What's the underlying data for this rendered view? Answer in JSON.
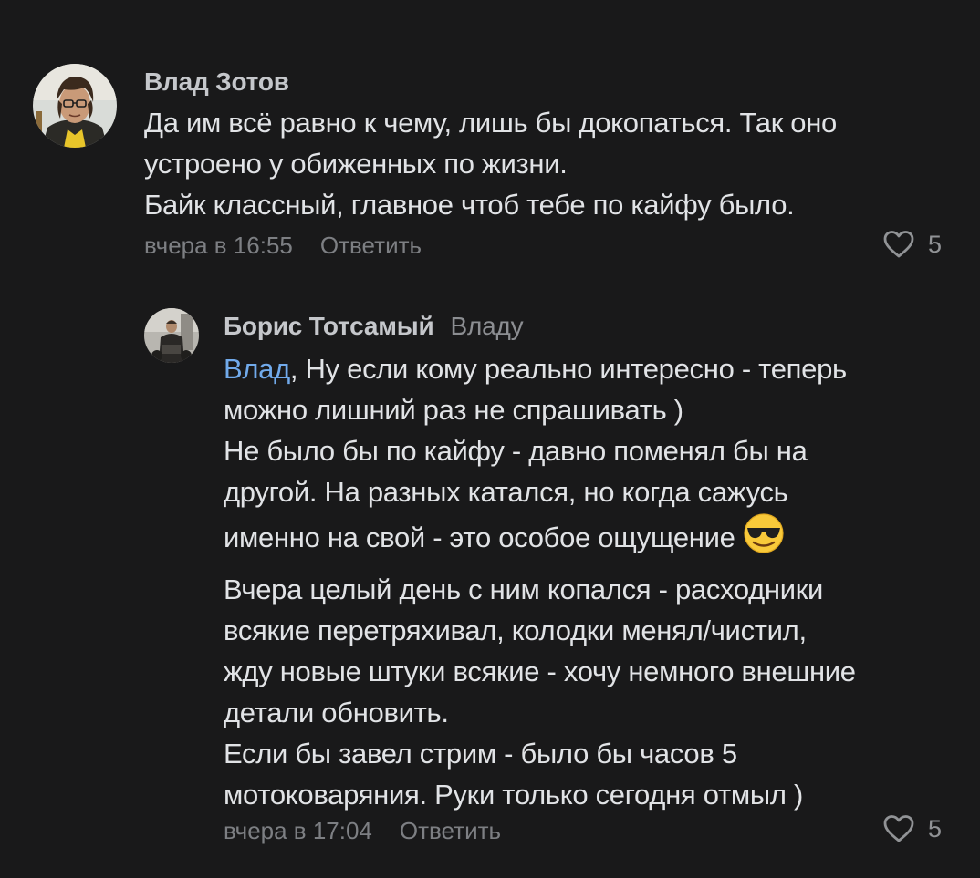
{
  "comments": [
    {
      "author": "Влад Зотов",
      "text_lines": [
        "Да им всё равно к чему, лишь бы докопаться. Так оно",
        "устроено у обиженных по жизни.",
        "Байк классный, главное чтоб тебе по кайфу было."
      ],
      "time": "вчера в 16:55",
      "reply_label": "Ответить",
      "likes": "5"
    },
    {
      "author": "Борис Тотсамый",
      "reply_to": "Владу",
      "mention": "Влад",
      "text_lines": [
        ", Ну если кому реально интересно - теперь",
        "можно лишний раз не спрашивать )",
        "Не было бы по кайфу - давно поменял бы на",
        "другой. На разных катался, но когда сажусь",
        "именно на свой - это особое ощущение",
        "Вчера целый день с ним копался - расходники",
        "всякие перетряхивал, колодки менял/чистил,",
        "жду новые штуки всякие - хочу немного внешние",
        "детали обновить.",
        "Если бы завел стрим - было бы часов 5",
        "мотоковаряния. Руки только сегодня отмыл )"
      ],
      "emoji": "sunglasses-emoji",
      "time": "вчера в 17:04",
      "reply_label": "Ответить",
      "likes": "5"
    }
  ],
  "colors": {
    "background": "#19191a",
    "text": "#e1e3e6",
    "author": "#c5c7cb",
    "secondary": "#7d7f83",
    "mention": "#71aaeb"
  }
}
